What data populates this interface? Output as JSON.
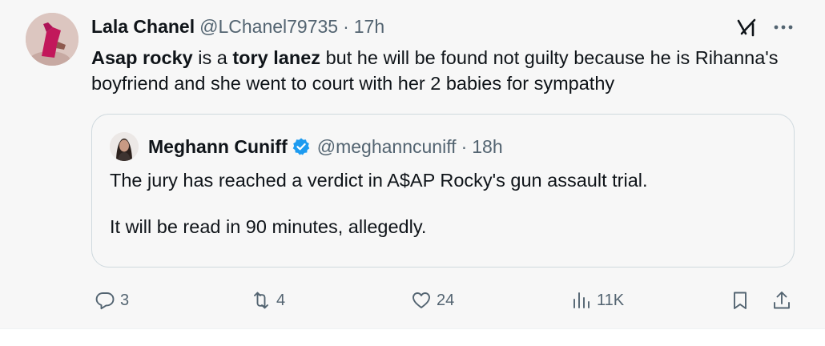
{
  "tweet": {
    "display_name": "Lala Chanel",
    "handle": "@LChanel79735",
    "separator": "·",
    "time": "17h",
    "text_parts": {
      "b1": "Asap rocky",
      "t1": " is a ",
      "b2": "tory lanez",
      "t2": " but he will be found not guilty because he is Rihanna's boyfriend and she went to court with her 2 babies for sympathy"
    }
  },
  "quote": {
    "display_name": "Meghann Cuniff",
    "handle": "@meghanncuniff",
    "separator": "·",
    "time": "18h",
    "verified": true,
    "paragraphs": [
      "The jury has reached a verdict in A$AP Rocky's gun assault trial.",
      "It will be read in 90 minutes, allegedly."
    ]
  },
  "actions": {
    "replies": "3",
    "reposts": "4",
    "likes": "24",
    "views": "11K"
  },
  "icons": {
    "top_right": [
      "grok-icon",
      "more-icon"
    ],
    "action_bar": [
      "reply-icon",
      "repost-icon",
      "like-icon",
      "views-icon",
      "bookmark-icon",
      "share-icon"
    ]
  },
  "colors": {
    "text_primary": "#0f1419",
    "text_secondary": "#536471",
    "verified_blue": "#1d9bf0",
    "border": "#cfd9de"
  }
}
